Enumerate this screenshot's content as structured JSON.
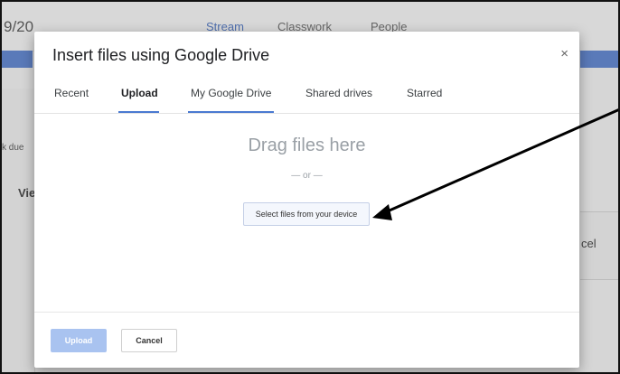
{
  "background": {
    "class_name": "9/20",
    "nav": [
      "Stream",
      "Classwork",
      "People"
    ],
    "left_snippet": "k due",
    "left_view": "Vie",
    "right_snippet": "cel"
  },
  "dialog": {
    "title": "Insert files using Google Drive",
    "close_label": "×",
    "tabs": [
      "Recent",
      "Upload",
      "My Google Drive",
      "Shared drives",
      "Starred"
    ],
    "selected_tab": "Upload",
    "drag_text": "Drag files here",
    "or_text": "— or —",
    "select_button": "Select files from your device",
    "upload_button": "Upload",
    "cancel_button": "Cancel"
  },
  "colors": {
    "accent": "#4a7ad1",
    "upload_disabled": "#a9c3f0",
    "annotation_arrow": "#000000"
  }
}
